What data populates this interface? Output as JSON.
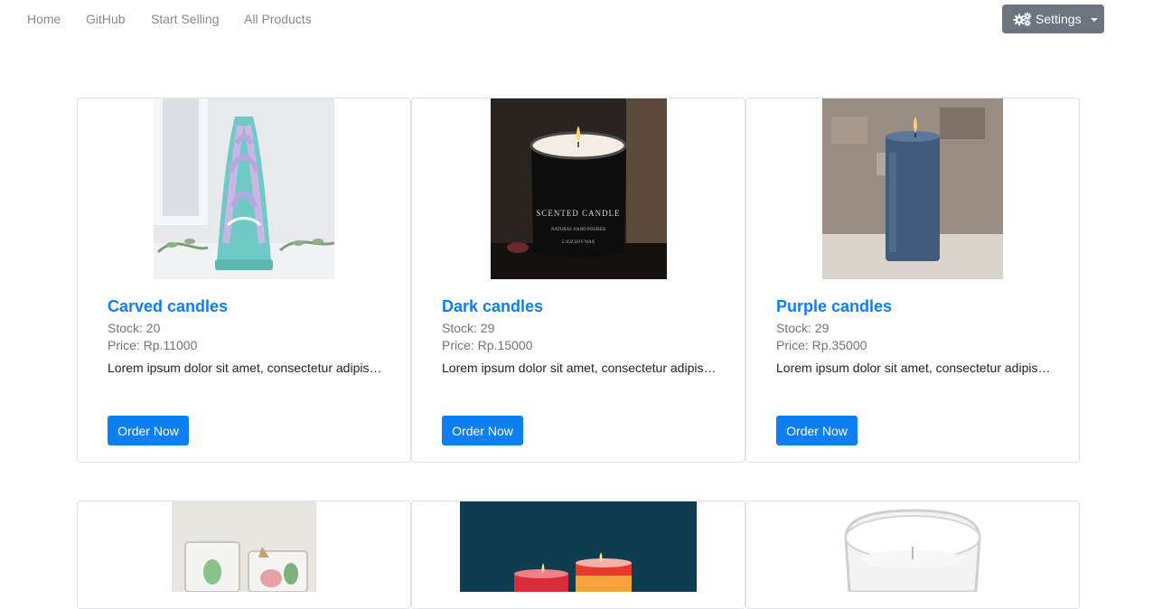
{
  "nav": {
    "links": [
      "Home",
      "GitHub",
      "Start Selling",
      "All Products"
    ],
    "settings_label": "Settings"
  },
  "products": [
    {
      "name": "Carved candles",
      "stock": "Stock: 20",
      "price": "Price: Rp.11000",
      "description": "Lorem ipsum dolor sit amet, consectetur adipiscing elit",
      "button": "Order Now"
    },
    {
      "name": "Dark candles",
      "stock": "Stock: 29",
      "price": "Price: Rp.15000",
      "description": "Lorem ipsum dolor sit amet, consectetur adipiscing elit",
      "button": "Order Now"
    },
    {
      "name": "Purple candles",
      "stock": "Stock: 29",
      "price": "Price: Rp.35000",
      "description": "Lorem ipsum dolor sit amet, consectetur adipiscing elit",
      "button": "Order Now"
    }
  ],
  "jar_label": {
    "line1": "SCENTED CANDLE",
    "line2": "NATURAL HAND POURED",
    "line3": "5.5OZ SOY WAX"
  },
  "colors": {
    "primary": "#0d7ff0",
    "secondary": "#6c757d",
    "nav_text": "#8a8a8a"
  }
}
